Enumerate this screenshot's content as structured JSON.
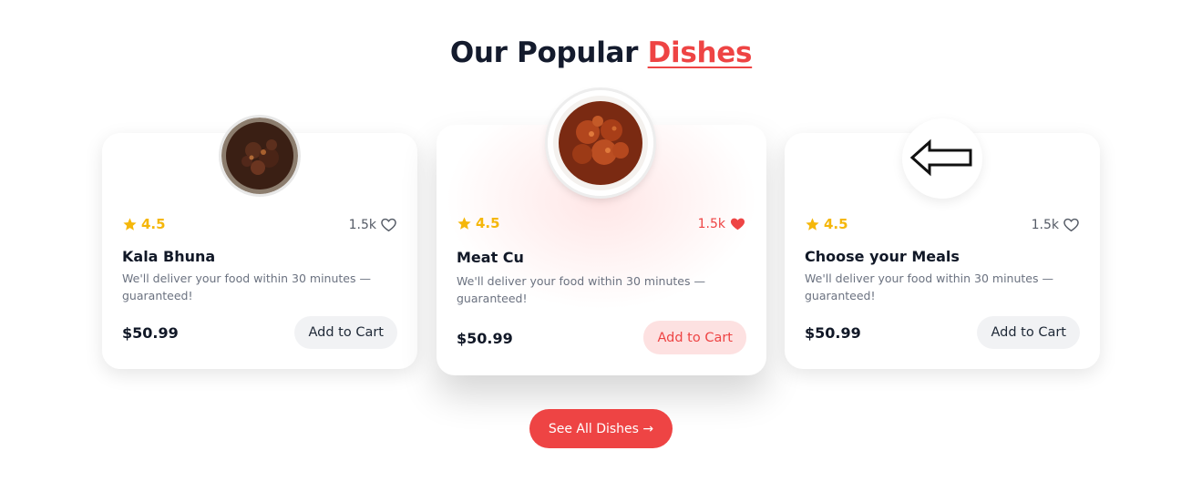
{
  "section": {
    "title_plain": "Our Popular ",
    "title_accent": "Dishes",
    "see_all_label": "See All Dishes →"
  },
  "cards": [
    {
      "name": "Kala Bhuna",
      "rating": "4.5",
      "likes": "1.5k",
      "liked": false,
      "description": "We'll deliver your food within 30 minutes — guaranteed!",
      "price": "$50.99",
      "cart_label": "Add to Cart",
      "image": "dish-photo"
    },
    {
      "name": "Meat Cu",
      "rating": "4.5",
      "likes": "1.5k",
      "liked": true,
      "description": "We'll deliver your food within 30 minutes — guaranteed!",
      "price": "$50.99",
      "cart_label": "Add to Cart",
      "image": "dish-photo"
    },
    {
      "name": "Choose your Meals",
      "rating": "4.5",
      "likes": "1.5k",
      "liked": false,
      "description": "We'll deliver your food within 30 minutes — guaranteed!",
      "price": "$50.99",
      "cart_label": "Add to Cart",
      "image": "arrow-left-icon"
    }
  ],
  "colors": {
    "accent": "#ee4444",
    "star": "#f5b70a",
    "heading": "#141b2d"
  }
}
